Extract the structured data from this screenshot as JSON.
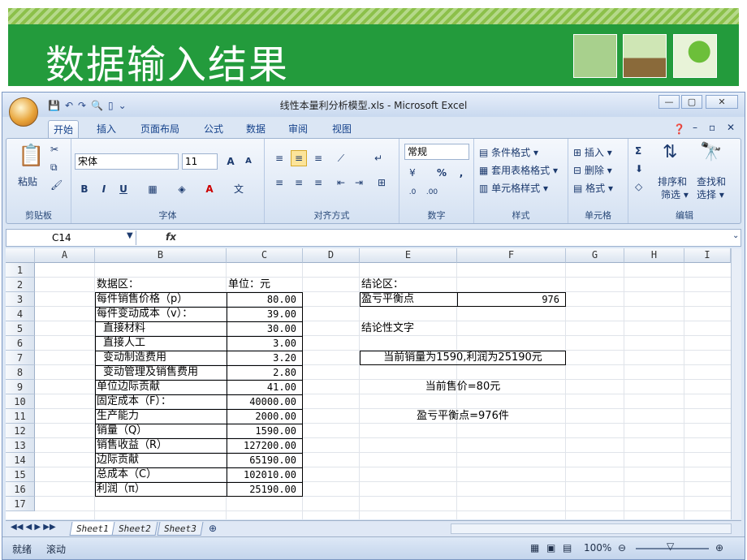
{
  "slide": {
    "title": "数据输入结果"
  },
  "window": {
    "title": "线性本量利分析模型.xls - Microsoft Excel",
    "controls": [
      "—",
      "▢",
      "✕"
    ]
  },
  "ribbon_tabs": [
    "开始",
    "插入",
    "页面布局",
    "公式",
    "数据",
    "审阅",
    "视图"
  ],
  "ribbon": {
    "clipboard": {
      "paste": "粘贴",
      "label": "剪贴板"
    },
    "font": {
      "name": "宋体",
      "size": "11",
      "bold": "B",
      "italic": "I",
      "underline": "U",
      "label": "字体"
    },
    "alignment": {
      "label": "对齐方式"
    },
    "number": {
      "format": "常规",
      "percent": "%",
      "comma": ",",
      "label": "数字"
    },
    "styles": {
      "conditional": "条件格式",
      "table": "套用表格格式",
      "cell": "单元格样式",
      "label": "样式"
    },
    "cells": {
      "insert": "插入",
      "delete": "删除",
      "format": "格式",
      "label": "单元格"
    },
    "editing": {
      "sigma": "Σ",
      "sort": "排序和",
      "filter": "筛选",
      "find": "查找和",
      "select": "选择",
      "label": "编辑"
    }
  },
  "formula_bar": {
    "name_box": "C14",
    "fx": "fx",
    "content": ""
  },
  "columns": [
    "A",
    "B",
    "C",
    "D",
    "E",
    "F",
    "G",
    "H",
    "I"
  ],
  "rows": [
    "1",
    "2",
    "3",
    "4",
    "5",
    "6",
    "7",
    "8",
    "9",
    "10",
    "11",
    "12",
    "13",
    "14",
    "15",
    "16",
    "17"
  ],
  "cells": {
    "B2": "数据区：",
    "C2": "单位：元",
    "B3": "每件销售价格（p）",
    "C3": "80.00",
    "B4": "每件变动成本（v）：",
    "C4": "39.00",
    "B5": "直接材料",
    "C5": "30.00",
    "B6": "直接人工",
    "C6": "3.00",
    "B7": "变动制造费用",
    "C7": "3.20",
    "B8": "变动管理及销售费用",
    "C8": "2.80",
    "B9": "单位边际贡献",
    "C9": "41.00",
    "B10": "固定成本（F）：",
    "C10": "40000.00",
    "B11": "生产能力",
    "C11": "2000.00",
    "B12": "销量（Q）",
    "C12": "1590.00",
    "B13": "销售收益（R）",
    "C13": "127200.00",
    "B14": "边际贡献",
    "C14": "65190.00",
    "B15": "总成本（C）",
    "C15": "102010.00",
    "B16": "利润（π）",
    "C16": "25190.00",
    "E2": "结论区：",
    "E3": "盈亏平衡点",
    "F3": "976",
    "E5": "结论性文字",
    "E7": "当前销量为1590,利润为25190元",
    "E9": "当前售价=80元",
    "E11": "盈亏平衡点=976件"
  },
  "sheets": [
    "Sheet1",
    "Sheet2",
    "Sheet3"
  ],
  "status": {
    "ready": "就绪",
    "scroll": "滚动",
    "zoom": "100%"
  }
}
